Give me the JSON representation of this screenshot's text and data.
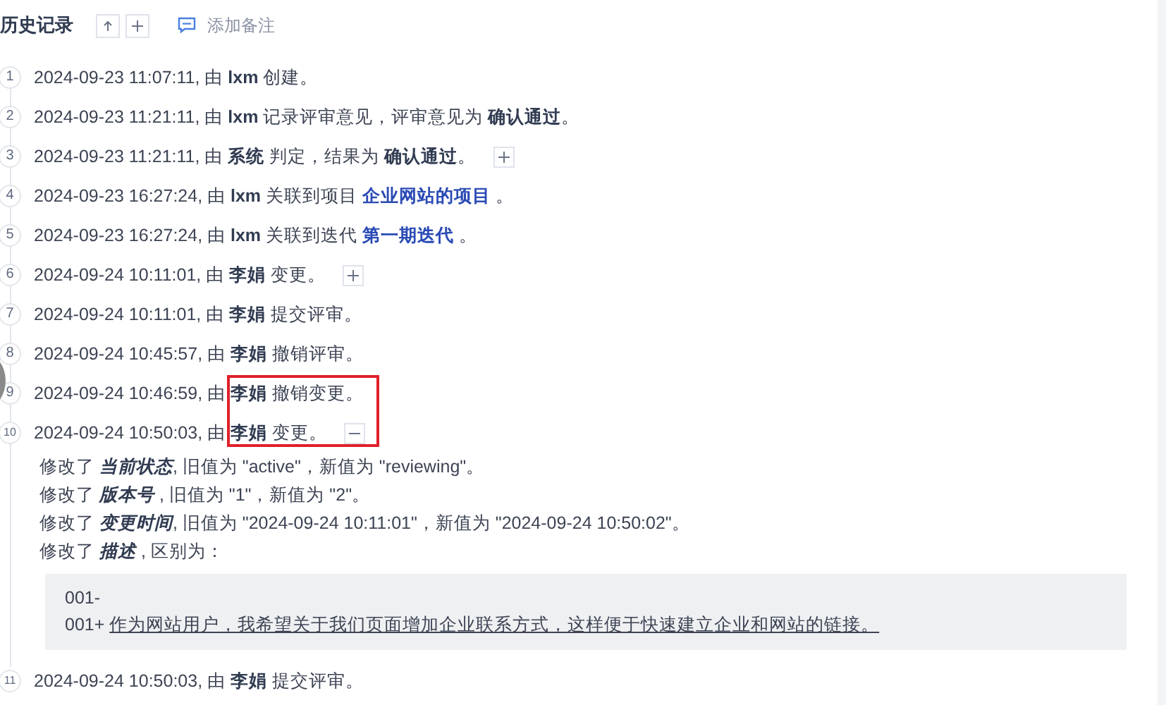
{
  "header": {
    "title": "历史记录",
    "buttons": [
      {
        "kind": "up"
      },
      {
        "kind": "add"
      }
    ],
    "note_action": "添加备注"
  },
  "entries": [
    {
      "number": "1",
      "highlighted": false,
      "parts": [
        {
          "kind": "plain",
          "text": "2024-09-23 11:07:11, 由 "
        },
        {
          "kind": "bold",
          "text": "lxm"
        },
        {
          "kind": "plain",
          "text": " 创建。"
        }
      ]
    },
    {
      "number": "2",
      "highlighted": false,
      "parts": [
        {
          "kind": "plain",
          "text": "2024-09-23 11:21:11, 由 "
        },
        {
          "kind": "bold",
          "text": "lxm"
        },
        {
          "kind": "plain",
          "text": " 记录评审意见，评审意见为 "
        },
        {
          "kind": "bold",
          "text": "确认通过"
        },
        {
          "kind": "plain",
          "text": "。"
        }
      ]
    },
    {
      "number": "3",
      "highlighted": false,
      "toggle": {
        "expanded": false
      },
      "parts": [
        {
          "kind": "plain",
          "text": "2024-09-23 11:21:11, 由 "
        },
        {
          "kind": "bold",
          "text": "系统"
        },
        {
          "kind": "plain",
          "text": " 判定，结果为 "
        },
        {
          "kind": "bold",
          "text": "确认通过"
        },
        {
          "kind": "plain",
          "text": "。"
        }
      ]
    },
    {
      "number": "4",
      "highlighted": false,
      "parts": [
        {
          "kind": "plain",
          "text": "2024-09-23 16:27:24, 由 "
        },
        {
          "kind": "bold",
          "text": "lxm"
        },
        {
          "kind": "plain",
          "text": " 关联到项目 "
        },
        {
          "kind": "link",
          "text": "企业网站的项目"
        },
        {
          "kind": "plain",
          "text": " 。"
        }
      ]
    },
    {
      "number": "5",
      "highlighted": false,
      "parts": [
        {
          "kind": "plain",
          "text": "2024-09-23 16:27:24, 由 "
        },
        {
          "kind": "bold",
          "text": "lxm"
        },
        {
          "kind": "plain",
          "text": " 关联到迭代 "
        },
        {
          "kind": "link",
          "text": "第一期迭代"
        },
        {
          "kind": "plain",
          "text": " 。"
        }
      ]
    },
    {
      "number": "6",
      "highlighted": false,
      "toggle": {
        "expanded": false
      },
      "parts": [
        {
          "kind": "plain",
          "text": "2024-09-24 10:11:01, 由 "
        },
        {
          "kind": "bold",
          "text": "李娟"
        },
        {
          "kind": "plain",
          "text": " 变更。"
        }
      ]
    },
    {
      "number": "7",
      "highlighted": false,
      "parts": [
        {
          "kind": "plain",
          "text": "2024-09-24 10:11:01, 由 "
        },
        {
          "kind": "bold",
          "text": "李娟"
        },
        {
          "kind": "plain",
          "text": " 提交评审。"
        }
      ]
    },
    {
      "number": "8",
      "highlighted": false,
      "parts": [
        {
          "kind": "plain",
          "text": "2024-09-24 10:45:57, 由 "
        },
        {
          "kind": "bold",
          "text": "李娟"
        },
        {
          "kind": "plain",
          "text": " 撤销评审。"
        }
      ]
    },
    {
      "number": "9",
      "highlighted": true,
      "parts": [
        {
          "kind": "plain",
          "text": "2024-09-24 10:46:59, 由 "
        },
        {
          "kind": "bold",
          "text": "李娟"
        },
        {
          "kind": "plain",
          "text": " 撤销变更。"
        }
      ]
    },
    {
      "number": "10",
      "highlighted": true,
      "toggle": {
        "expanded": true
      },
      "parts": [
        {
          "kind": "plain",
          "text": "2024-09-24 10:50:03, 由 "
        },
        {
          "kind": "bold",
          "text": "李娟"
        },
        {
          "kind": "plain",
          "text": " 变更。"
        }
      ],
      "changes": [
        [
          {
            "kind": "plain",
            "text": "修改了 "
          },
          {
            "kind": "field",
            "text": "当前状态"
          },
          {
            "kind": "plain",
            "text": ", 旧值为 \"active\"，新值为 \"reviewing\"。"
          }
        ],
        [
          {
            "kind": "plain",
            "text": "修改了 "
          },
          {
            "kind": "field",
            "text": "版本号"
          },
          {
            "kind": "plain",
            "text": " , 旧值为 \"1\"，新值为 \"2\"。"
          }
        ],
        [
          {
            "kind": "plain",
            "text": "修改了 "
          },
          {
            "kind": "field",
            "text": "变更时间"
          },
          {
            "kind": "plain",
            "text": ", 旧值为 \"2024-09-24 10:11:01\"，新值为 \"2024-09-24 10:50:02\"。"
          }
        ],
        [
          {
            "kind": "plain",
            "text": "修改了 "
          },
          {
            "kind": "field",
            "text": "描述"
          },
          {
            "kind": "plain",
            "text": " , 区别为："
          }
        ]
      ],
      "diff": [
        {
          "marker": "001-"
        },
        {
          "marker": "001+",
          "text": "作为网站用户，我希望关于我们页面增加企业联系方式，这样便于快速建立企业和网站的链接。"
        }
      ]
    },
    {
      "number": "11",
      "highlighted": false,
      "parts": [
        {
          "kind": "plain",
          "text": "2024-09-24 10:50:03, 由 "
        },
        {
          "kind": "bold",
          "text": "李娟"
        },
        {
          "kind": "plain",
          "text": " 提交评审。"
        }
      ]
    }
  ]
}
